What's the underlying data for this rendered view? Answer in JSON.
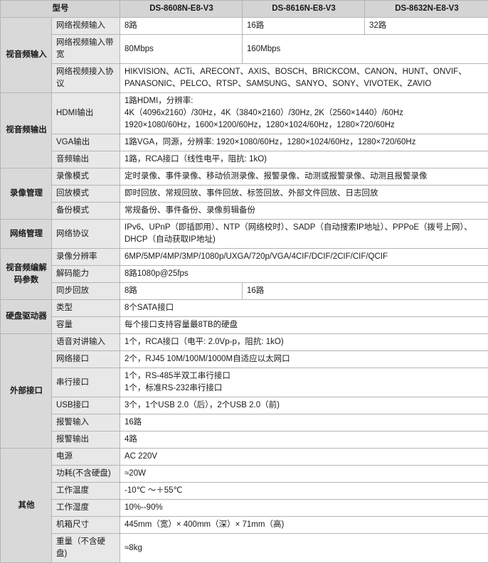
{
  "table": {
    "header": {
      "model_label": "型号",
      "models": [
        "DS-8608N-E8-V3",
        "DS-8616N-E8-V3",
        "DS-8632N-E8-V3"
      ]
    },
    "groups": [
      {
        "name": "视音频输入",
        "rows": [
          {
            "sub": "网络视频输入",
            "cells": [
              "8路",
              "16路",
              "32路"
            ]
          },
          {
            "sub": "网络视频输入带宽",
            "cells": [
              "80Mbps",
              "160Mbps"
            ]
          },
          {
            "sub": "网络视频接入协议",
            "lines": [
              "HIKVISION、ACTi、ARECONT、AXIS、BOSCH、BRICKCOM、CANON、HUNT、ONVIF、",
              "PANASONIC、PELCO、RTSP、SAMSUNG、SANYO、SONY、VIVOTEK、ZAVIO"
            ]
          }
        ]
      },
      {
        "name": "视音频输出",
        "rows": [
          {
            "sub": "HDMI输出",
            "lines": [
              "1路HDMI，分辨率:",
              "4K（4096x2160）/30Hz，4K（3840×2160）/30Hz, 2K（2560×1440）/60Hz",
              "1920×1080/60Hz，1600×1200/60Hz，1280×1024/60Hz，1280×720/60Hz"
            ]
          },
          {
            "sub": "VGA输出",
            "lines": [
              "1路VGA，同源，分辨率: 1920×1080/60Hz，1280×1024/60Hz，1280×720/60Hz"
            ]
          },
          {
            "sub": "音频输出",
            "lines": [
              "1路，RCA接口（线性电平，阻抗: 1kO)"
            ]
          }
        ]
      },
      {
        "name": "录像管理",
        "rows": [
          {
            "sub": "录像模式",
            "lines": [
              "定时录像、事件录像、移动侦测录像、报警录像、动测或报警录像、动测且报警录像"
            ]
          },
          {
            "sub": "回放模式",
            "lines": [
              "即时回放、常规回放、事件回放、标签回放、外部文件回放、日志回放"
            ]
          },
          {
            "sub": "备份模式",
            "lines": [
              "常规备份、事件备份、录像剪辑备份"
            ]
          }
        ]
      },
      {
        "name": "网络管理",
        "rows": [
          {
            "sub": "网络协议",
            "lines": [
              "IPv6、UPnP（即插即用）、NTP（网络校时）、SADP（自动搜索IP地址）、PPPoE（拨号上网）、",
              "DHCP（自动获取IP地址)"
            ]
          }
        ]
      },
      {
        "name": "视音频编解码参数",
        "rows": [
          {
            "sub": "录像分辨率",
            "lines": [
              "6MP/5MP/4MP/3MP/1080p/UXGA/720p/VGA/4CIF/DCIF/2CIF/CIF/QCIF"
            ]
          },
          {
            "sub": "解码能力",
            "lines": [
              "8路1080p@25fps"
            ]
          },
          {
            "sub": "同步回放",
            "cells": [
              "8路",
              "16路"
            ]
          }
        ]
      },
      {
        "name": "硬盘驱动器",
        "rows": [
          {
            "sub": "类型",
            "lines": [
              "8个SATA接口"
            ]
          },
          {
            "sub": "容量",
            "lines": [
              "每个接口支持容量最8TB的硬盘"
            ]
          }
        ]
      },
      {
        "name": "外部接口",
        "rows": [
          {
            "sub": "语音对讲输入",
            "lines": [
              "1个，RCA接口（电平: 2.0Vp-p，阻抗: 1kO)"
            ]
          },
          {
            "sub": "网络接口",
            "lines": [
              "2个，RJ45 10M/100M/1000M自适应以太网口"
            ]
          },
          {
            "sub": "串行接口",
            "lines": [
              "1个，RS-485半双工串行接口",
              "1个，标准RS-232串行接口"
            ]
          },
          {
            "sub": "USB接口",
            "lines": [
              "3个，1个USB 2.0（后），2个USB 2.0（前)"
            ]
          },
          {
            "sub": "报警输入",
            "lines": [
              "16路"
            ]
          },
          {
            "sub": "报警输出",
            "lines": [
              "4路"
            ]
          }
        ]
      },
      {
        "name": "其他",
        "rows": [
          {
            "sub": "电源",
            "lines": [
              "AC 220V"
            ]
          },
          {
            "sub": "功耗(不含硬盘)",
            "lines": [
              "≈20W"
            ]
          },
          {
            "sub": "工作温度",
            "lines": [
              "-10℃ ～＋55℃"
            ]
          },
          {
            "sub": "工作湿度",
            "lines": [
              "10%--90%"
            ]
          },
          {
            "sub": "机箱尺寸",
            "lines": [
              "445mm（宽）× 400mm（深）× 71mm（高)"
            ]
          },
          {
            "sub": "重量（不含硬盘)",
            "lines": [
              "≈8kg"
            ]
          }
        ]
      }
    ]
  }
}
